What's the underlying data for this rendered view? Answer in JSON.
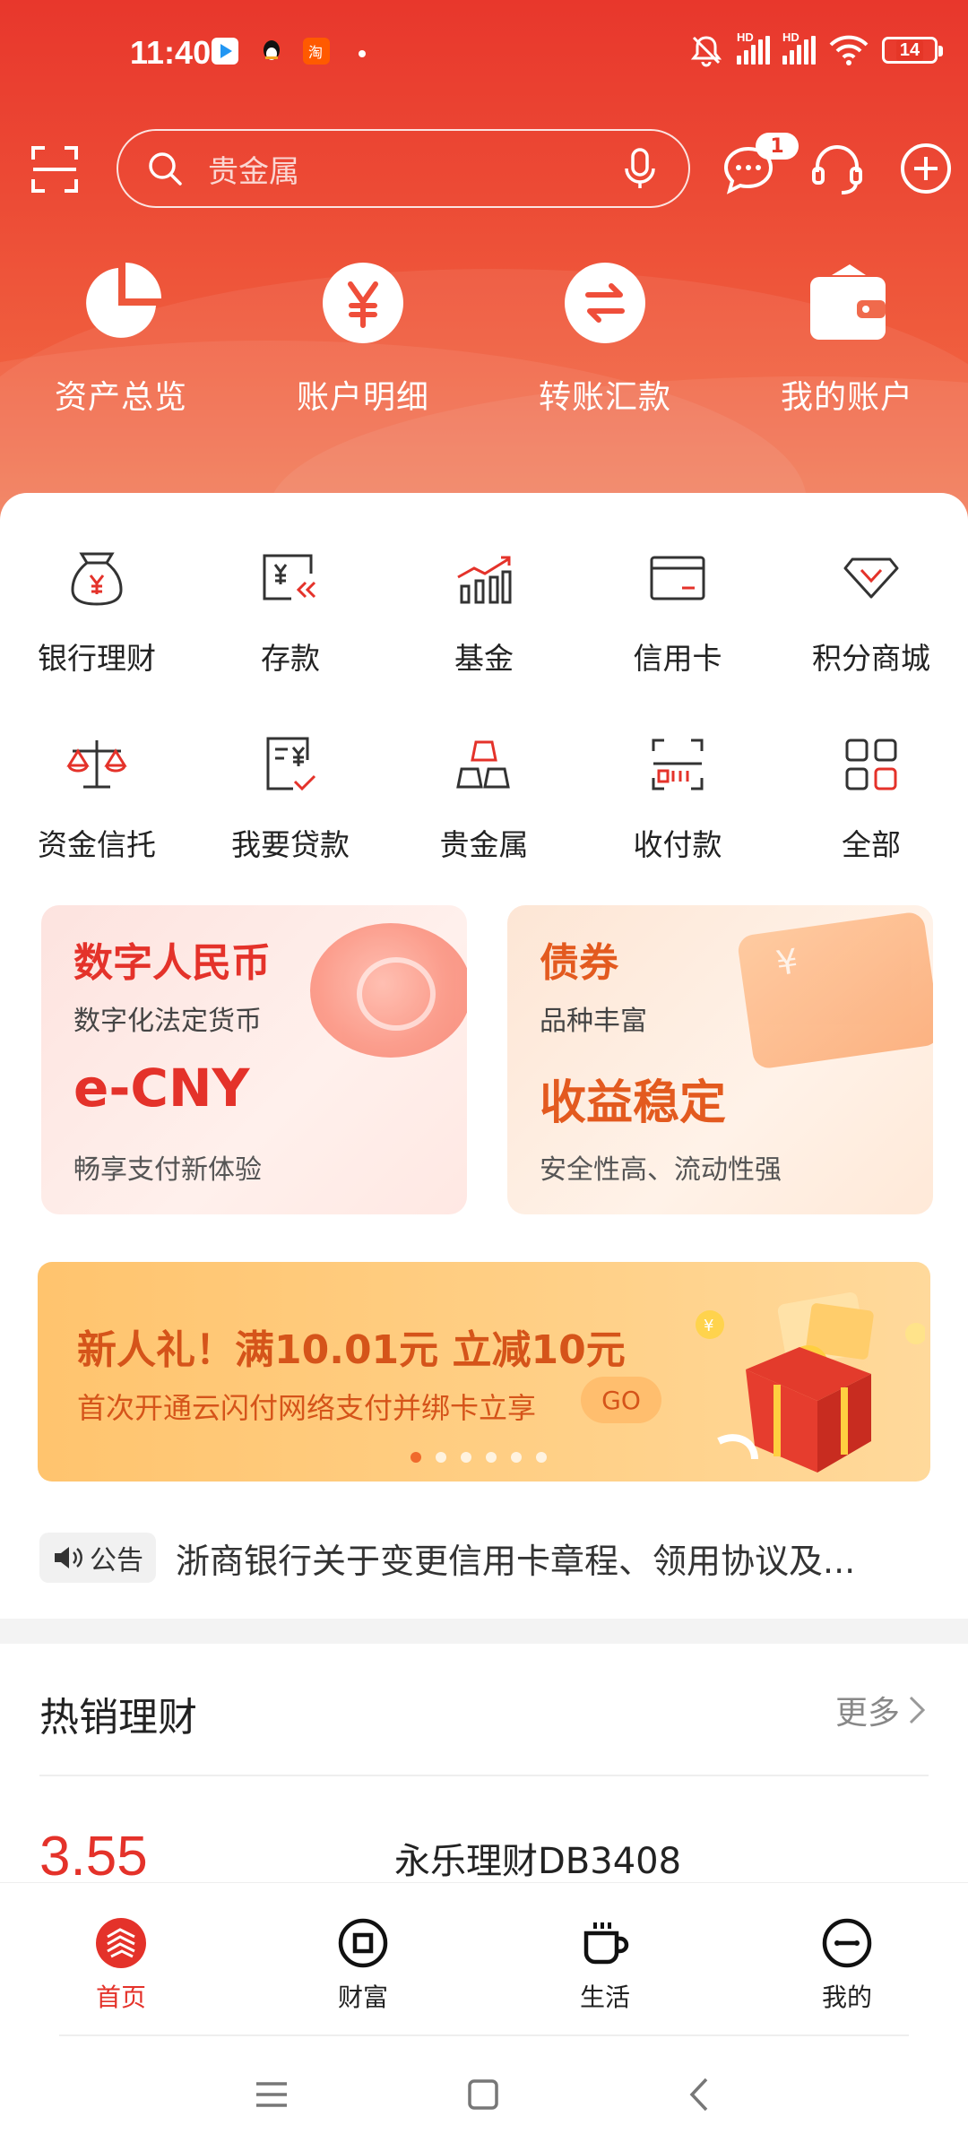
{
  "status_bar": {
    "time": "11:40",
    "battery": "14",
    "network_labels": [
      "HD",
      "HD"
    ]
  },
  "search": {
    "placeholder": "贵金属",
    "message_badge": "1"
  },
  "quick_actions": [
    {
      "label": "资产总览",
      "icon": "pie-chart-icon"
    },
    {
      "label": "账户明细",
      "icon": "yen-icon"
    },
    {
      "label": "转账汇款",
      "icon": "transfer-icon"
    },
    {
      "label": "我的账户",
      "icon": "wallet-icon"
    }
  ],
  "services": [
    [
      {
        "label": "银行理财",
        "icon": "money-bag-icon"
      },
      {
        "label": "存款",
        "icon": "deposit-icon"
      },
      {
        "label": "基金",
        "icon": "fund-chart-icon"
      },
      {
        "label": "信用卡",
        "icon": "credit-card-icon"
      },
      {
        "label": "积分商城",
        "icon": "diamond-icon"
      }
    ],
    [
      {
        "label": "资金信托",
        "icon": "scale-icon"
      },
      {
        "label": "我要贷款",
        "icon": "loan-icon"
      },
      {
        "label": "贵金属",
        "icon": "gold-bars-icon"
      },
      {
        "label": "收付款",
        "icon": "scan-pay-icon"
      },
      {
        "label": "全部",
        "icon": "grid-icon"
      }
    ]
  ],
  "cards": [
    {
      "title": "数字人民币",
      "subtitle": "数字化法定货币",
      "big": "e-CNY",
      "footer": "畅享支付新体验"
    },
    {
      "title": "债券",
      "subtitle": "品种丰富",
      "big": "收益稳定",
      "footer": "安全性高、流动性强"
    }
  ],
  "promo": {
    "title": "新人礼！满10.01元 立减10元",
    "subtitle": "首次开通云闪付网络支付并绑卡立享",
    "go_label": "GO",
    "pages": 6,
    "active_page": 1
  },
  "notice": {
    "tag": "公告",
    "text": "浙商银行关于变更信用卡章程、领用协议及..."
  },
  "hot": {
    "title": "热销理财",
    "more": "更多",
    "first_rate": "3.55",
    "first_name": "永乐理财DB3408"
  },
  "tabs": [
    {
      "label": "首页",
      "active": true
    },
    {
      "label": "财富",
      "active": false
    },
    {
      "label": "生活",
      "active": false
    },
    {
      "label": "我的",
      "active": false
    }
  ],
  "colors": {
    "brand_red": "#e4322a",
    "promo_orange": "#d5541a"
  }
}
